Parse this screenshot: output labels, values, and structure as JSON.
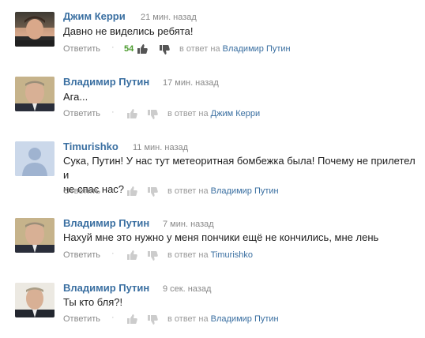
{
  "colors": {
    "author": "#3a6fa1",
    "likes": "#4a9a2d",
    "meta": "#888888"
  },
  "comments": [
    {
      "author": "Джим Керри",
      "time": "21 мин. назад",
      "text": "Давно не виделись ребята!",
      "reply_label": "Ответить",
      "likes": "54",
      "in_reply_prefix": "в ответ на",
      "in_reply_to": "Владимир Путин",
      "avatar": "photo"
    },
    {
      "author": "Владимир Путин",
      "time": "17 мин. назад",
      "text": "Ага...",
      "reply_label": "Ответить",
      "likes": "",
      "in_reply_prefix": "в ответ на",
      "in_reply_to": "Джим Керри",
      "avatar": "photo"
    },
    {
      "author": "Timurishko",
      "time": "11 мин. назад",
      "text_line1": "Сука, Путин! У нас тут метеоритная бомбежка была! Почему не прилетел и",
      "text_line2": "не спас нас?",
      "reply_label": "Ответить",
      "likes": "",
      "in_reply_prefix": "в ответ на",
      "in_reply_to": "Владимир Путин",
      "avatar": "default-user-icon"
    },
    {
      "author": "Владимир Путин",
      "time": "7 мин. назад",
      "text": "Нахуй мне это нужно у меня пончики ещё не кончились, мне лень",
      "reply_label": "Ответить",
      "likes": "",
      "in_reply_prefix": "в ответ на",
      "in_reply_to": "Timurishko",
      "avatar": "photo"
    },
    {
      "author": "Владимир Путин",
      "time": "9 сек. назад",
      "text": "Ты кто бля?!",
      "reply_label": "Ответить",
      "likes": "",
      "in_reply_prefix": "в ответ на",
      "in_reply_to": "Владимир Путин",
      "avatar": "photo"
    }
  ]
}
